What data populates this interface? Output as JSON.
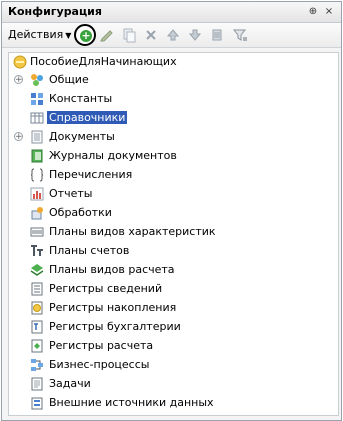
{
  "window": {
    "title": "Конфигурация",
    "pin_glyph": "⊕",
    "close_glyph": "×"
  },
  "toolbar": {
    "actions_label": "Действия",
    "buttons": [
      "add-icon",
      "edit-icon",
      "copy-icon",
      "delete-icon",
      "move-up-icon",
      "move-down-icon",
      "sort-icon",
      "filter-icon"
    ]
  },
  "tree": {
    "root": {
      "label": "ПособиеДляНачинающих",
      "icon": "configuration-icon"
    },
    "items": [
      {
        "label": "Общие",
        "icon": "common-icon",
        "expandable": true
      },
      {
        "label": "Константы",
        "icon": "constants-icon",
        "expandable": false
      },
      {
        "label": "Справочники",
        "icon": "catalogs-icon",
        "expandable": false,
        "selected": true
      },
      {
        "label": "Документы",
        "icon": "documents-icon",
        "expandable": true
      },
      {
        "label": "Журналы документов",
        "icon": "document-journals-icon",
        "expandable": false
      },
      {
        "label": "Перечисления",
        "icon": "enumerations-icon",
        "expandable": false
      },
      {
        "label": "Отчеты",
        "icon": "reports-icon",
        "expandable": false
      },
      {
        "label": "Обработки",
        "icon": "data-processors-icon",
        "expandable": false
      },
      {
        "label": "Планы видов характеристик",
        "icon": "chart-of-characteristic-types-icon",
        "expandable": false
      },
      {
        "label": "Планы счетов",
        "icon": "chart-of-accounts-icon",
        "expandable": false
      },
      {
        "label": "Планы видов расчета",
        "icon": "chart-of-calculation-types-icon",
        "expandable": false
      },
      {
        "label": "Регистры сведений",
        "icon": "information-registers-icon",
        "expandable": false
      },
      {
        "label": "Регистры накопления",
        "icon": "accumulation-registers-icon",
        "expandable": false
      },
      {
        "label": "Регистры бухгалтерии",
        "icon": "accounting-registers-icon",
        "expandable": false
      },
      {
        "label": "Регистры расчета",
        "icon": "calculation-registers-icon",
        "expandable": false
      },
      {
        "label": "Бизнес-процессы",
        "icon": "business-processes-icon",
        "expandable": false
      },
      {
        "label": "Задачи",
        "icon": "tasks-icon",
        "expandable": false
      },
      {
        "label": "Внешние источники данных",
        "icon": "external-data-sources-icon",
        "expandable": false
      }
    ]
  },
  "colors": {
    "selection": "#2f5bb7",
    "add_button": "#39a23a"
  }
}
